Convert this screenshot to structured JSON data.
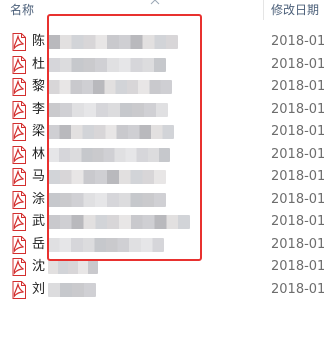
{
  "header": {
    "name_label": "名称",
    "date_label": "修改日期"
  },
  "files": [
    {
      "name": "陈",
      "date": "2018-01-"
    },
    {
      "name": "杜",
      "date": "2018-01-"
    },
    {
      "name": "黎",
      "date": "2018-01-"
    },
    {
      "name": "李",
      "date": "2018-01-"
    },
    {
      "name": "梁",
      "date": "2018-01-"
    },
    {
      "name": "林",
      "date": "2018-01-"
    },
    {
      "name": "马",
      "date": "2018-01-"
    },
    {
      "name": "涂",
      "date": "2018-01-"
    },
    {
      "name": "武",
      "date": "2018-01-"
    },
    {
      "name": "岳",
      "date": "2018-01-"
    },
    {
      "name": "沈",
      "date": "2018-01-"
    },
    {
      "name": "刘",
      "date": "2018-01-"
    }
  ],
  "icons": {
    "file_icon": "pdf-file-icon",
    "sort": "sort-arrow-icon"
  },
  "colors": {
    "highlight": "#e8312f",
    "pdf_red": "#d32f2f",
    "header_text": "#4c607a",
    "date_text": "#6d6d6d"
  }
}
